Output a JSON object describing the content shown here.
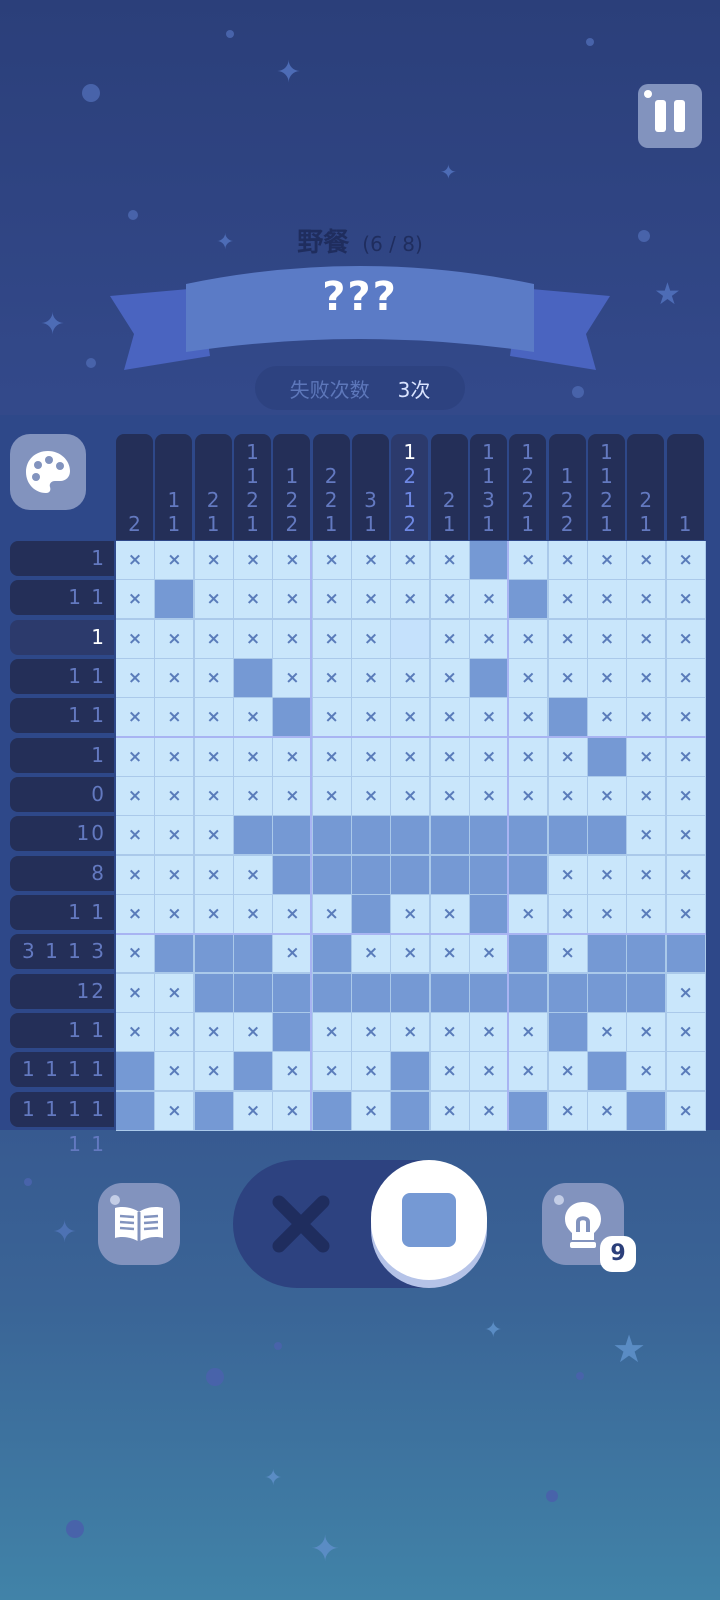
{
  "colors": {
    "background_top": "#2b3f7a",
    "background_bottom": "#4183a8",
    "cell_empty": "#c9e6fb",
    "cell_filled": "#7599d4",
    "clue_bg": "#242f58",
    "clue_text": "#6379c0",
    "highlight_text": "#ffffff"
  },
  "header": {
    "pause_icon": "pause-icon",
    "level_name": "野餐",
    "level_progress": "(6 / 8)",
    "puzzle_title": "???",
    "fail_label": "失败次数",
    "fail_value": "3次"
  },
  "board": {
    "palette_icon": "palette-icon",
    "active_row": 2,
    "active_col": 7,
    "column_clues": [
      [
        "2"
      ],
      [
        "1",
        "1"
      ],
      [
        "2",
        "1"
      ],
      [
        "1",
        "1",
        "2",
        "1"
      ],
      [
        "1",
        "2",
        "2"
      ],
      [
        "2",
        "2",
        "1"
      ],
      [
        "3",
        "1"
      ],
      [
        "1",
        "2",
        "1",
        "2"
      ],
      [
        "2",
        "1"
      ],
      [
        "1",
        "1",
        "3",
        "1"
      ],
      [
        "1",
        "2",
        "2",
        "1"
      ],
      [
        "1",
        "2",
        "2"
      ],
      [
        "1",
        "1",
        "2",
        "1"
      ],
      [
        "2",
        "1"
      ],
      [
        "1"
      ]
    ],
    "row_clues": [
      "1",
      "1 1",
      "1",
      "1 1",
      "1 1",
      "1",
      "0",
      "10",
      "8",
      "1 1",
      "3 1 1 3",
      "12",
      "1 1",
      "1 1 1 1",
      "1 1 1 1 1 1"
    ],
    "cells": [
      "xxxxxxxxxfxxxxx",
      "xfxxxxxxxxfxxxx",
      "xxxxxxx.xxxxxxx",
      "xxxfxxxxxfxxxxx",
      "xxxxfxxxxxxfxxx",
      "xxxxxxxxxxxxfxx",
      "xxxxxxxxxxxxxxx",
      "xxxffffffffffxx",
      "xxxxfffffffxxxx",
      "xxxxxxfxxfxxxxx",
      "xfffxfxxxxfxfff",
      "xxffffffffffffx",
      "xxxxfxxxxxxfxxx",
      "fxxfxxxfxxxxfxx",
      "fxfxxfxfxxfxxfx"
    ],
    "mark_symbol": "×"
  },
  "controls": {
    "book_icon": "book-icon",
    "mode_x_icon": "cross-icon",
    "mode_fill_icon": "square-fill-icon",
    "mode_selected": "fill",
    "hint_icon": "lightbulb-icon",
    "hint_count": "9"
  }
}
